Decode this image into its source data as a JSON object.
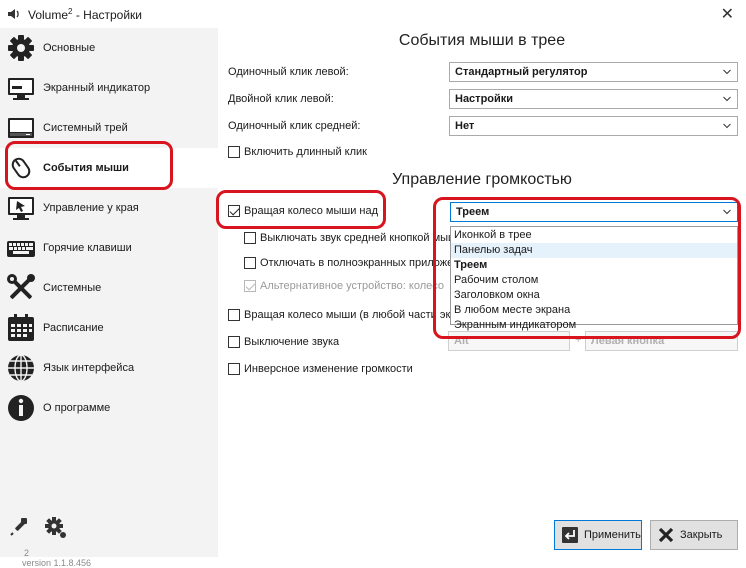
{
  "window": {
    "title_main": "Volume",
    "title_sup": "2",
    "title_sep": " - ",
    "title_rest": "Настройки",
    "close_glyph": "✕"
  },
  "sidebar": {
    "items": [
      {
        "label": "Основные",
        "icon": "gear-icon"
      },
      {
        "label": "Экранный индикатор",
        "icon": "monitor-icon"
      },
      {
        "label": "Системный трей",
        "icon": "tray-icon"
      },
      {
        "label": "События мыши",
        "icon": "mouse-icon",
        "active": true
      },
      {
        "label": "Управление у края",
        "icon": "screen-edge-icon"
      },
      {
        "label": "Горячие клавиши",
        "icon": "keyboard-icon"
      },
      {
        "label": "Системные",
        "icon": "tools-icon"
      },
      {
        "label": "Расписание",
        "icon": "calendar-icon"
      },
      {
        "label": "Язык интерфейса",
        "icon": "globe-icon"
      },
      {
        "label": "О программе",
        "icon": "info-icon"
      }
    ],
    "version_sup": "2",
    "version": "version 1.1.8.456"
  },
  "mouse_events": {
    "title": "События мыши в трее",
    "single_left_label": "Одиночный клик левой:",
    "single_left_value": "Стандартный регулятор",
    "double_left_label": "Двойной клик левой:",
    "double_left_value": "Настройки",
    "single_middle_label": "Одиночный клик средней:",
    "single_middle_value": "Нет",
    "long_click_label": "Включить длинный клик"
  },
  "volume_control": {
    "title": "Управление громкостью",
    "wheel_over_label": "Вращая колесо мыши над",
    "wheel_over_value": "Треем",
    "mute_middle_label": "Выключать звук средней кнопкой мыши",
    "disable_fullscreen_label": "Отключать в полноэкранных приложениях",
    "alt_device_label": "Альтернативное устройство: колесо",
    "wheel_anywhere_label": "Вращая колесо мыши (в любой части экрана)",
    "mute_label": "Выключение звука",
    "mute_mod_value": "Alt",
    "plus_sign": "+",
    "mute_button_value": "Левая кнопка",
    "inverse_label": "Инверсное изменение громкости"
  },
  "dropdown_options": [
    "Иконкой в трее",
    "Панелью задач",
    "Треем",
    "Рабочим столом",
    "Заголовком окна",
    "В любом месте экрана",
    "Экранным индикатором"
  ],
  "buttons": {
    "apply": "Применить",
    "close": "Закрыть"
  },
  "colors": {
    "highlight": "#d8141e",
    "accent": "#0078d7",
    "hover": "#e5f1fb"
  }
}
